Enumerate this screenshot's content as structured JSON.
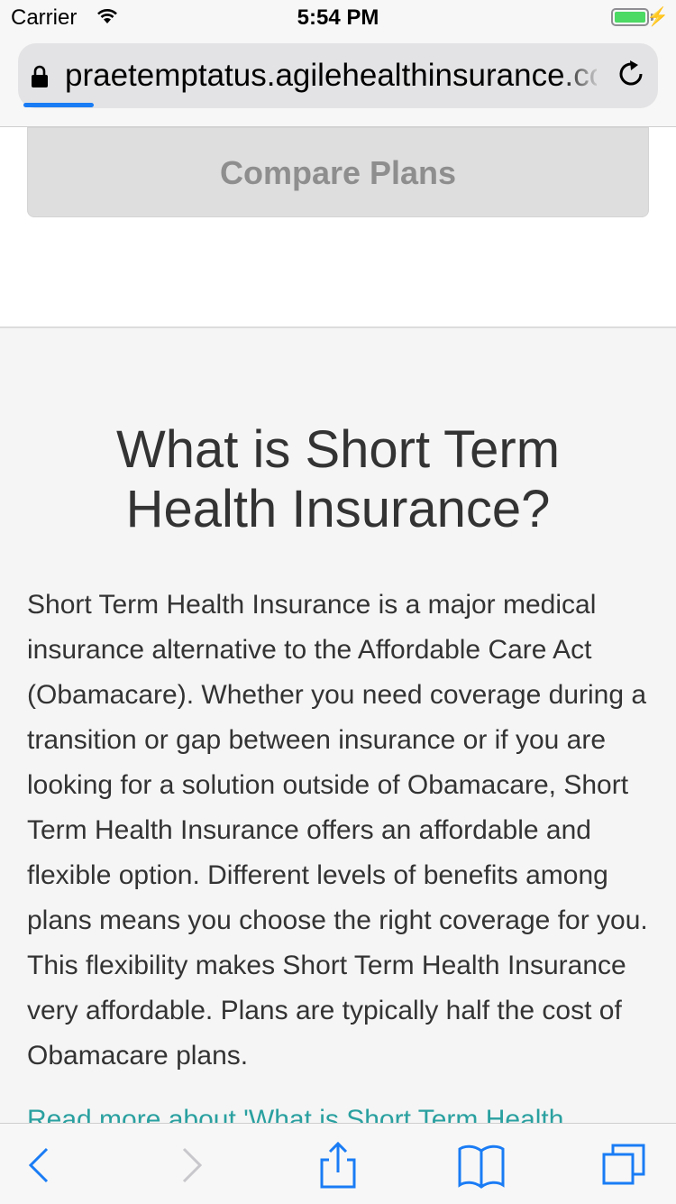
{
  "status_bar": {
    "carrier": "Carrier",
    "time": "5:54 PM",
    "battery_color": "#4cd964"
  },
  "browser": {
    "url": "praetemptatus.agilehealthinsurance.com",
    "progress_color": "#1a7cf5",
    "icons": [
      "lock-icon",
      "reload-icon"
    ]
  },
  "top_section": {
    "compare_button_label": "Compare Plans"
  },
  "article": {
    "heading_line1": "What is Short Term",
    "heading_line2": "Health Insurance?",
    "paragraph": "Short Term Health Insurance is a major medical insurance alternative to the Affordable Care Act (Obamacare). Whether you need coverage during a transition or gap between insurance or if you are looking for a solution outside of Obamacare, Short Term Health Insurance offers an affordable and flexible option. Different levels of benefits among plans means you choose the right coverage for you. This flexibility makes Short Term Health Insurance very affordable. Plans are typically half the cost of Obamacare plans.",
    "read_more": "Read more about 'What is Short Term Health",
    "link_color": "#2aa0a0"
  },
  "toolbar": {
    "icons": [
      "back-icon",
      "forward-icon",
      "share-icon",
      "bookmarks-icon",
      "tabs-icon"
    ],
    "accent_color": "#1a7cf5"
  }
}
